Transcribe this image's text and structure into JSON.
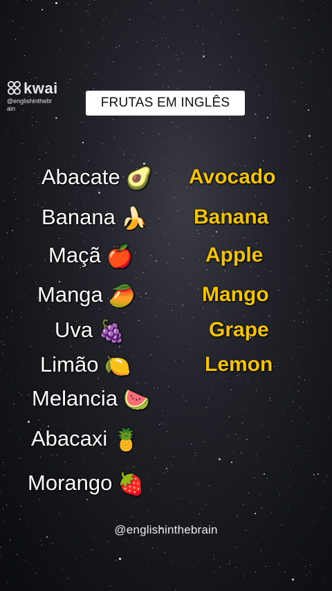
{
  "brand": {
    "name": "kwai",
    "handle": "@englishinthebrain"
  },
  "title": "FRUTAS EM INGLÊS",
  "fruits": [
    {
      "pt": "Abacate",
      "emoji": "🥑",
      "en": "Avocado"
    },
    {
      "pt": "Banana",
      "emoji": "🍌",
      "en": "Banana"
    },
    {
      "pt": "Maçã",
      "emoji": "🍎",
      "en": "Apple"
    },
    {
      "pt": "Manga",
      "emoji": "🥭",
      "en": "Mango"
    },
    {
      "pt": "Uva",
      "emoji": "🍇",
      "en": "Grape"
    },
    {
      "pt": "Limão",
      "emoji": "🍋",
      "en": "Lemon"
    },
    {
      "pt": "Melancia",
      "emoji": "🍉",
      "en": ""
    },
    {
      "pt": "Abacaxi",
      "emoji": "🍍",
      "en": ""
    },
    {
      "pt": "Morango",
      "emoji": "🍓",
      "en": ""
    }
  ],
  "footer": "@englishinthebrain",
  "colors": {
    "english_text": "#f5c400",
    "portuguese_text": "#ffffff",
    "background": "#141519"
  }
}
